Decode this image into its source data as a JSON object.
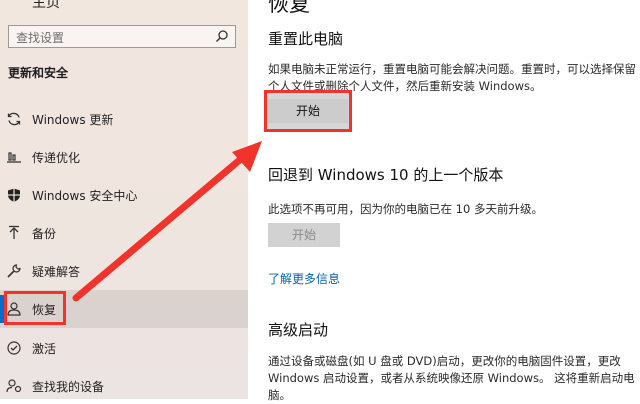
{
  "sidebar": {
    "top_label": "主页",
    "search_placeholder": "查找设置",
    "section_title": "更新和安全",
    "items": [
      {
        "label": "Windows 更新",
        "icon": "sync-icon"
      },
      {
        "label": "传递优化",
        "icon": "delivery-optimization-icon"
      },
      {
        "label": "Windows 安全中心",
        "icon": "shield-icon"
      },
      {
        "label": "备份",
        "icon": "backup-arrow-icon"
      },
      {
        "label": "疑难解答",
        "icon": "wrench-icon"
      },
      {
        "label": "恢复",
        "icon": "recovery-icon",
        "active": true
      },
      {
        "label": "激活",
        "icon": "check-circle-icon"
      },
      {
        "label": "查找我的设备",
        "icon": "person-location-icon"
      }
    ]
  },
  "main": {
    "page_title": "恢复",
    "reset": {
      "heading": "重置此电脑",
      "description": "如果电脑未正常运行，重置电脑可能会解决问题。重置时，可以选择保留个人文件或删除个人文件，然后重新安装 Windows。",
      "button": "开始"
    },
    "rollback": {
      "heading": "回退到 Windows 10 的上一个版本",
      "description": "此选项不再可用，因为你的电脑已在 10 多天前升级。",
      "button": "开始",
      "link": "了解更多信息"
    },
    "advanced": {
      "heading": "高级启动",
      "description": "通过设备或磁盘(如 U 盘或 DVD)启动，更改你的电脑固件设置，更改 Windows 启动设置，或者从系统映像还原 Windows。 这将重新启动电脑。"
    }
  },
  "colors": {
    "accent": "#0a6cc4",
    "annotation": "#f0342b",
    "link": "#0a5fb3"
  }
}
